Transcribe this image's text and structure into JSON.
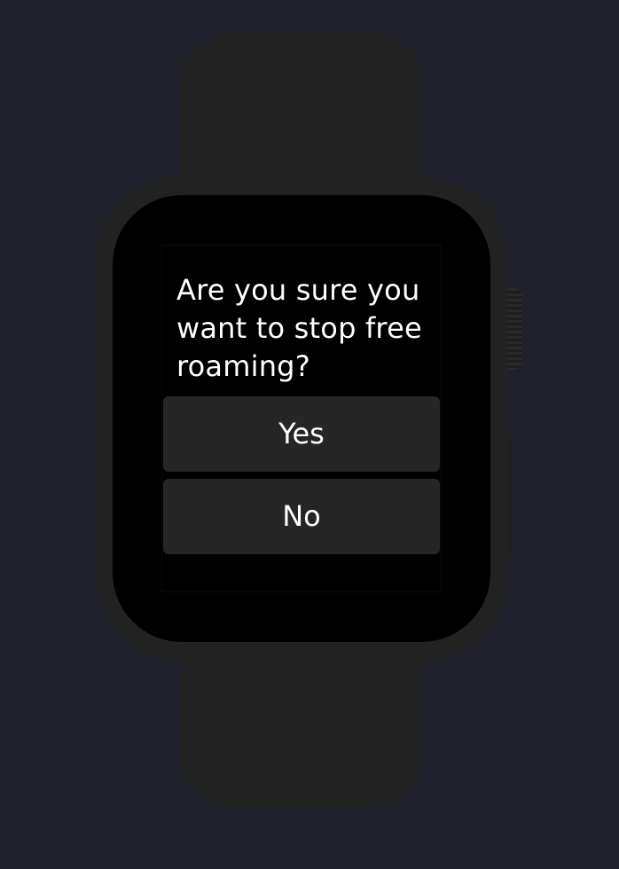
{
  "dialog": {
    "message": "Are you sure you want to stop free roaming?",
    "yes_label": "Yes",
    "no_label": "No"
  },
  "colors": {
    "background": "#1e212b",
    "watch_body": "#222222",
    "screen": "#000000",
    "button": "#262626",
    "text": "#ffffff"
  },
  "icons": {
    "crown": "digital-crown",
    "side_button": "side-button"
  }
}
